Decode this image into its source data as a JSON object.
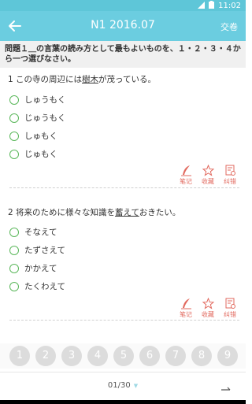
{
  "status": {
    "time": "11:02"
  },
  "appbar": {
    "title": "N1 2016.07",
    "submit_label": "交卷"
  },
  "instruction": "問題１＿の言葉の読み方として最もよいものを、１・２・３・４から一つ選びなさい。",
  "questions": [
    {
      "prefix": "1 この寺の周辺には",
      "target": "樹木",
      "suffix": "が茂っている。",
      "options": [
        "しゅうもく",
        "じゅうもく",
        "しゅもく",
        "じゅもく"
      ]
    },
    {
      "prefix": "2 将来のために様々な知識を",
      "target": "蓄えて",
      "suffix": "おきたい。",
      "options": [
        "そなえて",
        "たずさえて",
        "かかえて",
        "たくわえて"
      ]
    }
  ],
  "actions": {
    "note": "笔记",
    "favorite": "收藏",
    "report": "纠错"
  },
  "numbers": [
    "1",
    "2",
    "3",
    "4",
    "5",
    "6",
    "7",
    "8",
    "9"
  ],
  "pagination": {
    "indicator": "01/30"
  }
}
